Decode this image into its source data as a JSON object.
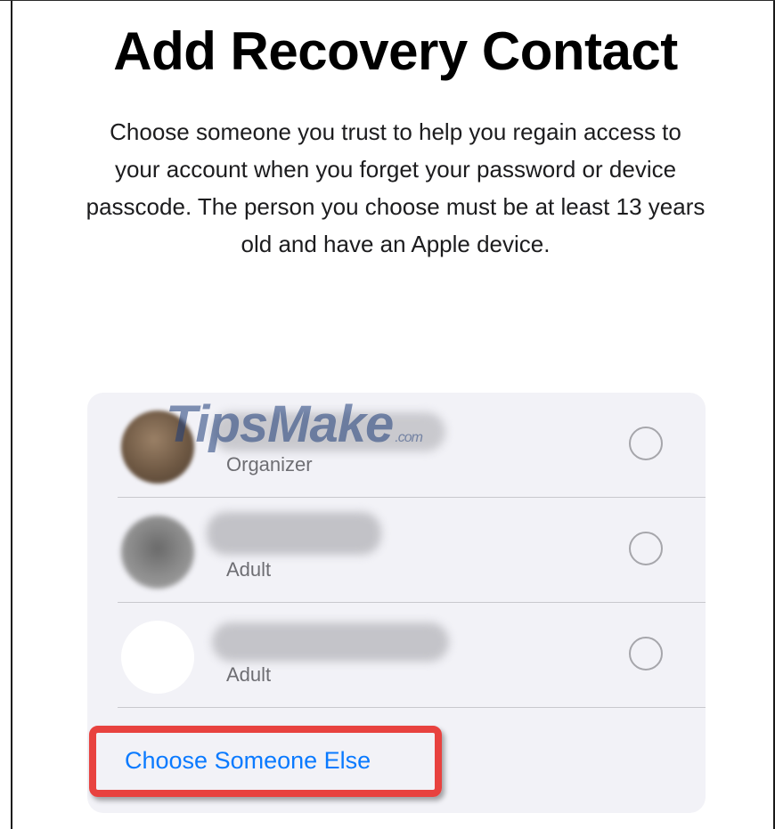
{
  "header": {
    "title": "Add Recovery Contact",
    "description": "Choose someone you trust to help you regain access to your account when you forget your password or device passcode. The person you choose must be at least 13 years old and have an Apple device."
  },
  "contacts": [
    {
      "role": "Organizer",
      "selected": false
    },
    {
      "role": "Adult",
      "selected": false
    },
    {
      "role": "Adult",
      "selected": false
    }
  ],
  "actions": {
    "choose_someone_else": "Choose Someone Else"
  },
  "watermark": {
    "main": "TipsMake",
    "suffix": ".com"
  },
  "colors": {
    "link": "#0a7aff",
    "highlight": "#e8423f",
    "card_background": "#f2f2f7"
  }
}
